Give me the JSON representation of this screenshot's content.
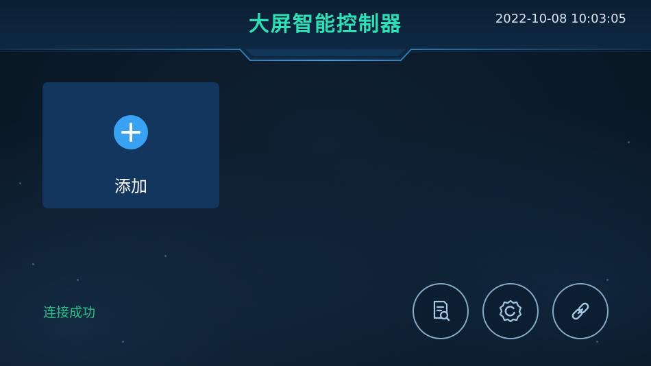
{
  "header": {
    "title": "大屏智能控制器",
    "datetime": "2022-10-08 10:03:05"
  },
  "add_card": {
    "label": "添加"
  },
  "status": {
    "text": "连接成功"
  },
  "actions": [
    {
      "icon": "document-search-icon"
    },
    {
      "icon": "gear-icon"
    },
    {
      "icon": "link-icon"
    }
  ],
  "colors": {
    "title": "#2fe0b6",
    "status": "#2fc08a",
    "card": "#13365e",
    "accent": "#3aa2f3",
    "ring": "#8aa9c4"
  }
}
